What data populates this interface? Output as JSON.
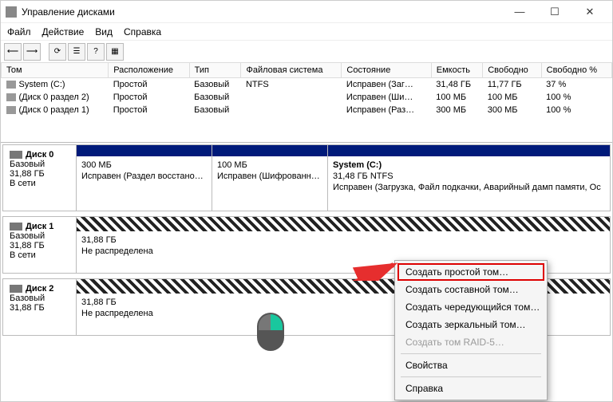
{
  "window": {
    "title": "Управление дисками"
  },
  "menu": {
    "file": "Файл",
    "action": "Действие",
    "view": "Вид",
    "help": "Справка"
  },
  "columns": {
    "vol": "Том",
    "layout": "Расположение",
    "type": "Тип",
    "fs": "Файловая система",
    "status": "Состояние",
    "cap": "Емкость",
    "free": "Свободно",
    "freepct": "Свободно %"
  },
  "volumes": [
    {
      "name": "System (C:)",
      "layout": "Простой",
      "type": "Базовый",
      "fs": "NTFS",
      "status": "Исправен (Заг…",
      "cap": "31,48 ГБ",
      "free": "11,77 ГБ",
      "pct": "37 %"
    },
    {
      "name": "(Диск 0 раздел 2)",
      "layout": "Простой",
      "type": "Базовый",
      "fs": "",
      "status": "Исправен (Ши…",
      "cap": "100 МБ",
      "free": "100 МБ",
      "pct": "100 %"
    },
    {
      "name": "(Диск 0 раздел 1)",
      "layout": "Простой",
      "type": "Базовый",
      "fs": "",
      "status": "Исправен (Раз…",
      "cap": "300 МБ",
      "free": "300 МБ",
      "pct": "100 %"
    }
  ],
  "disks": {
    "d0": {
      "title": "Диск 0",
      "type": "Базовый",
      "size": "31,88 ГБ",
      "status": "В сети",
      "p0": {
        "l1": "",
        "l2": "300 МБ",
        "l3": "Исправен (Раздел восстановления"
      },
      "p1": {
        "l1": "",
        "l2": "100 МБ",
        "l3": "Исправен (Шифрованный ("
      },
      "p2": {
        "l1": "System  (C:)",
        "l2": "31,48 ГБ NTFS",
        "l3": "Исправен (Загрузка, Файл подкачки, Аварийный дамп памяти, Ос"
      }
    },
    "d1": {
      "title": "Диск 1",
      "type": "Базовый",
      "size": "31,88 ГБ",
      "status": "В сети",
      "p0": {
        "l2": "31,88 ГБ",
        "l3": "Не распределена"
      }
    },
    "d2": {
      "title": "Диск 2",
      "type": "Базовый",
      "size": "31,88 ГБ",
      "status": "",
      "p0": {
        "l2": "31,88 ГБ",
        "l3": "Не распределена"
      }
    }
  },
  "context": {
    "i0": "Создать простой том…",
    "i1": "Создать составной том…",
    "i2": "Создать чередующийся том…",
    "i3": "Создать зеркальный том…",
    "i4": "Создать том RAID-5…",
    "i5": "Свойства",
    "i6": "Справка"
  }
}
